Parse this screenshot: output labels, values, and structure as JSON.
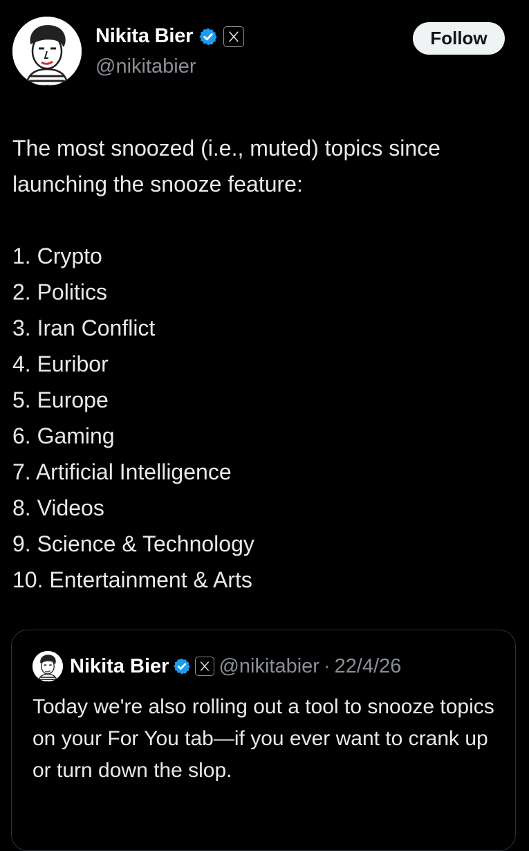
{
  "post": {
    "author": {
      "name": "Nikita Bier",
      "handle": "@nikitabier"
    },
    "follow_label": "Follow",
    "intro": "The most snoozed (i.e., muted) topics since launching the snooze feature:",
    "topics": [
      "1. Crypto",
      "2. Politics",
      "3. Iran Conflict",
      "4. Euribor",
      "5. Europe",
      "6. Gaming",
      "7. Artificial Intelligence",
      "8. Videos",
      "9. Science & Technology",
      "10. Entertainment & Arts"
    ]
  },
  "quoted_post": {
    "author": {
      "name": "Nikita Bier",
      "handle": "@nikitabier"
    },
    "separator": "·",
    "date": "22/4/26",
    "text": "Today we're also rolling out a tool to snooze topics on your For You tab—if you ever want to crank up or turn down the slop."
  },
  "icons": {
    "verified": "verified-badge-icon",
    "affiliate": "x-logo-icon",
    "avatar": "avatar-sketch"
  },
  "colors": {
    "background": "#000000",
    "text": "#e7e9ea",
    "secondary_text": "#8b9096",
    "verified_blue": "#1d9bf0",
    "follow_button_bg": "#eff3f4",
    "card_border": "#2f3336"
  }
}
